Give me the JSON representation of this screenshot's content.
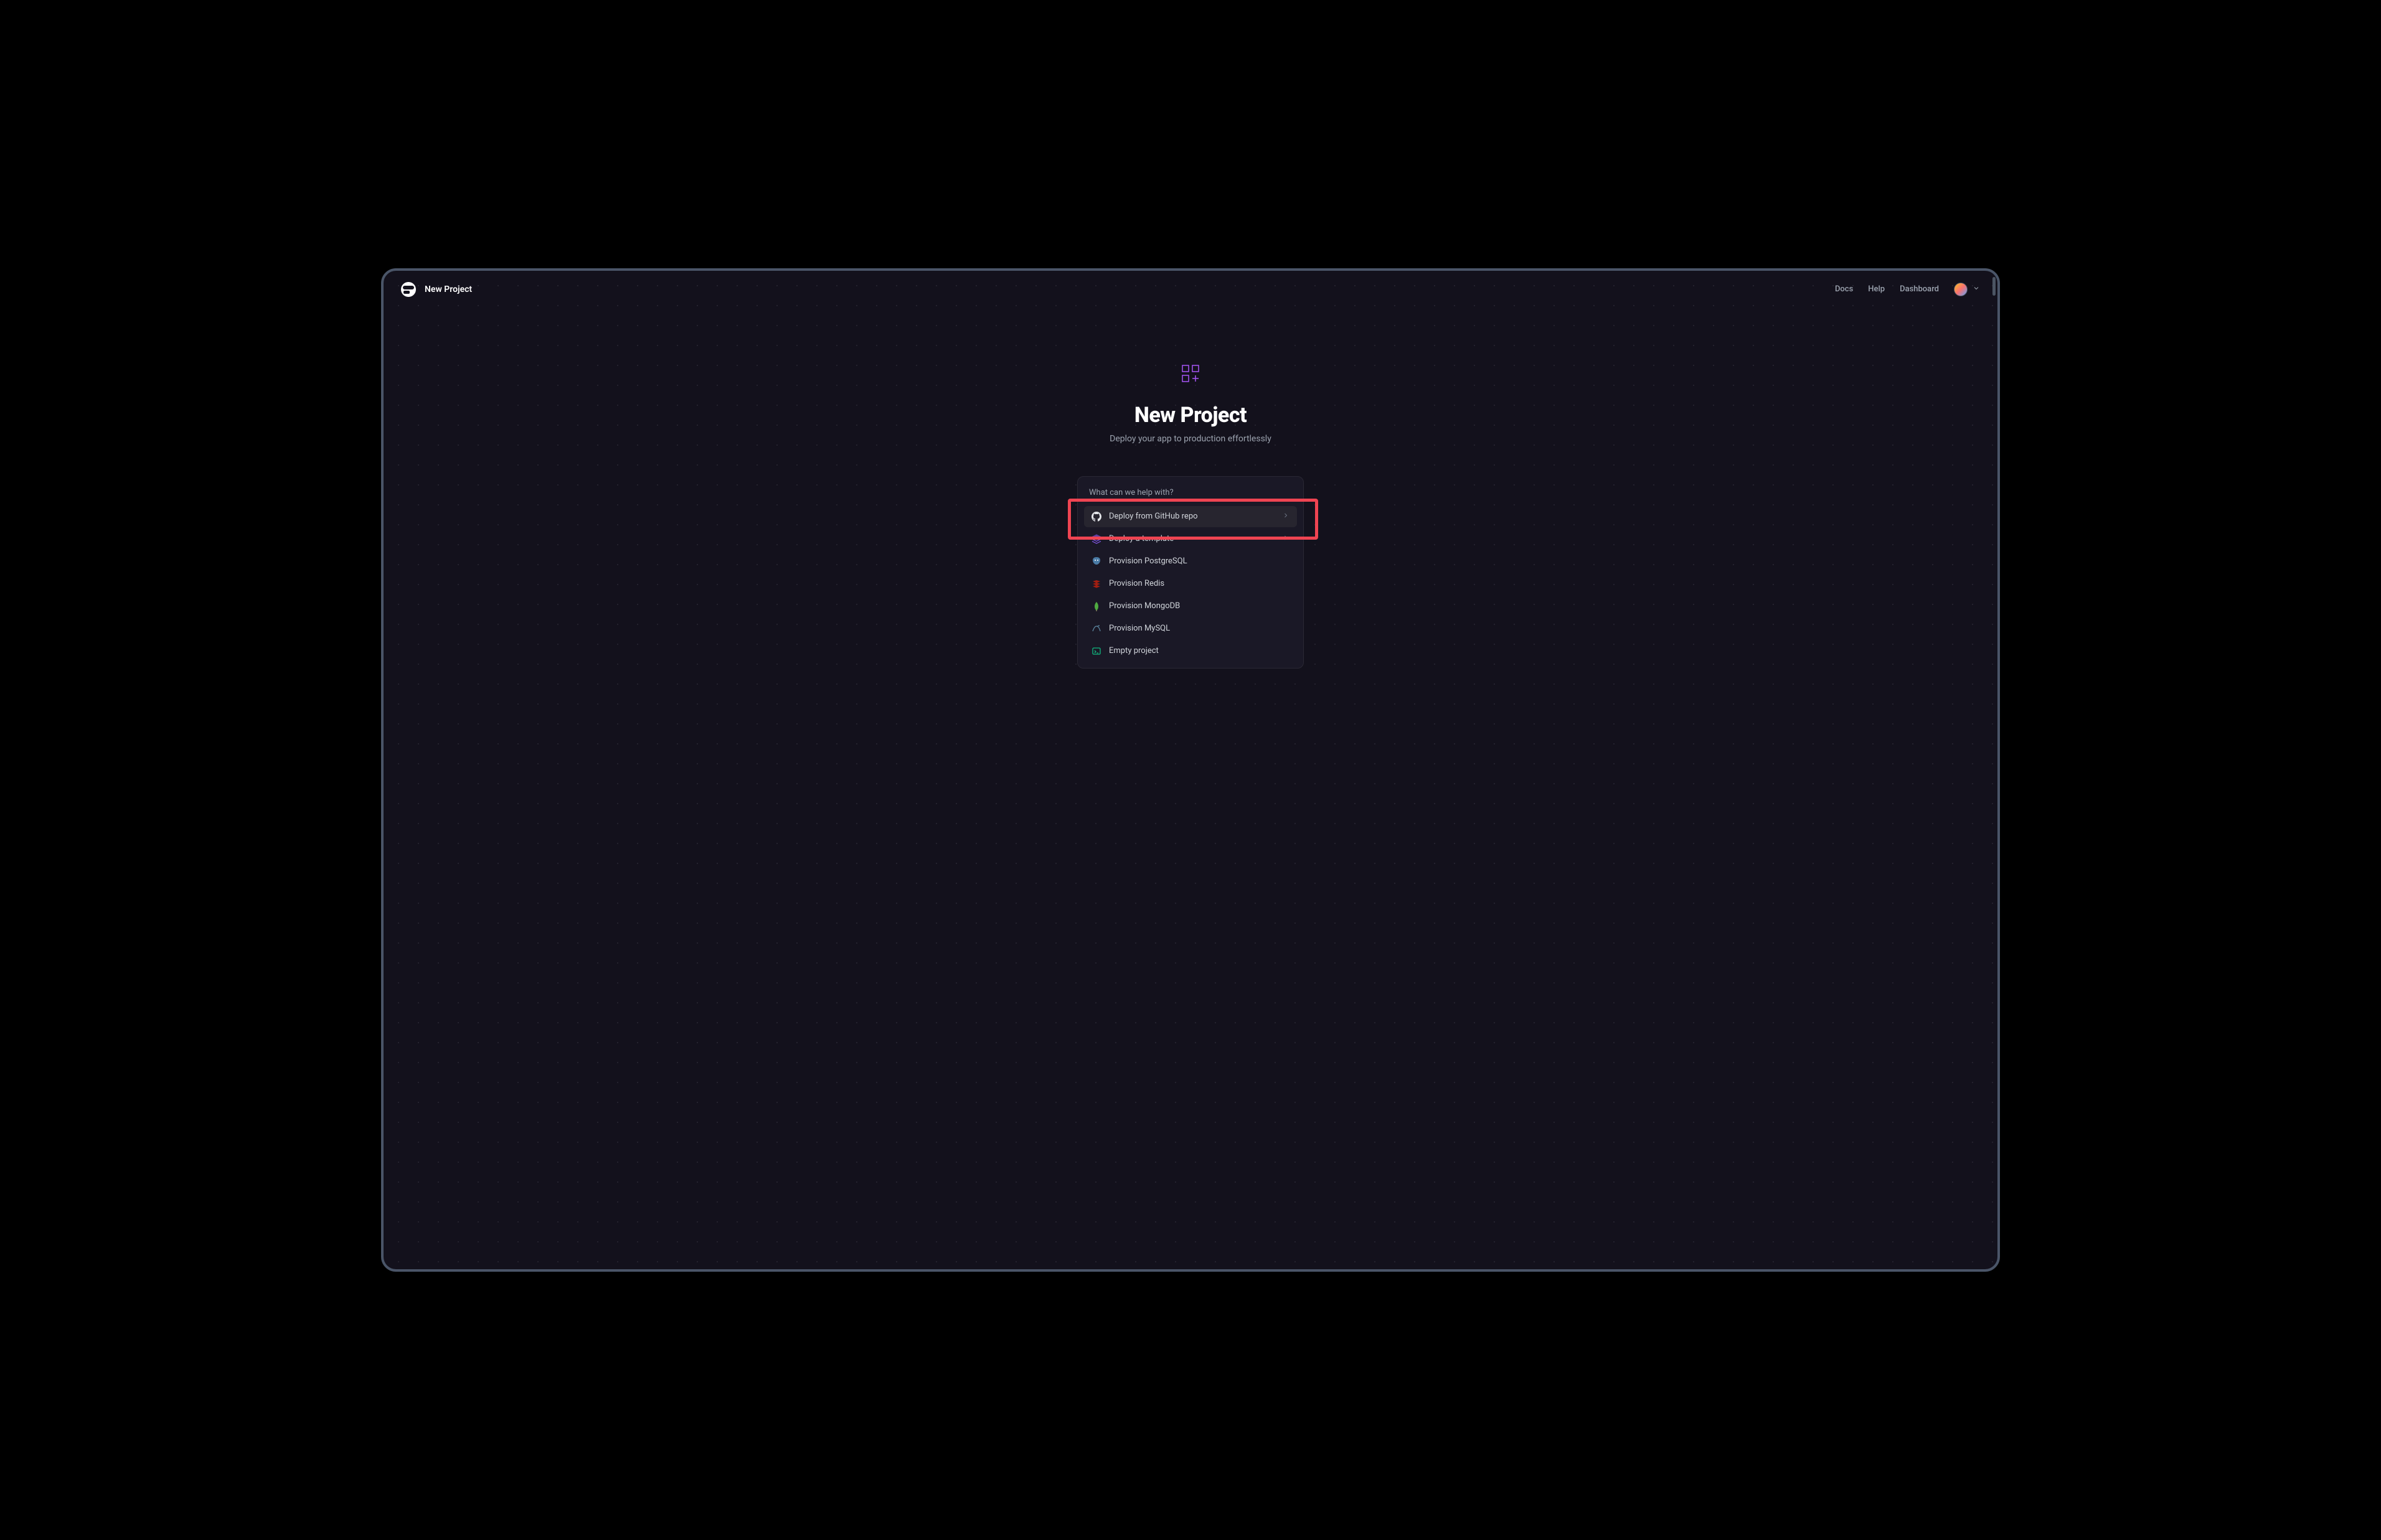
{
  "header": {
    "title": "New Project",
    "nav": {
      "docs": "Docs",
      "help": "Help",
      "dashboard": "Dashboard"
    }
  },
  "hero": {
    "title": "New Project",
    "subtitle": "Deploy your app to production effortlessly"
  },
  "panel": {
    "prompt": "What can we help with?",
    "options": [
      {
        "label": "Deploy from GitHub repo",
        "icon": "github-icon",
        "selected": true,
        "has_chevron": true
      },
      {
        "label": "Deploy a template",
        "icon": "template-icon",
        "selected": false,
        "has_chevron": true
      },
      {
        "label": "Provision PostgreSQL",
        "icon": "postgresql-icon",
        "selected": false,
        "has_chevron": false
      },
      {
        "label": "Provision Redis",
        "icon": "redis-icon",
        "selected": false,
        "has_chevron": false
      },
      {
        "label": "Provision MongoDB",
        "icon": "mongodb-icon",
        "selected": false,
        "has_chevron": false
      },
      {
        "label": "Provision MySQL",
        "icon": "mysql-icon",
        "selected": false,
        "has_chevron": false
      },
      {
        "label": "Empty project",
        "icon": "empty-project-icon",
        "selected": false,
        "has_chevron": false
      }
    ]
  },
  "annotation": {
    "highlighted_option_index": 0
  },
  "colors": {
    "bg": "#13111C",
    "panel": "#1a1826",
    "accent_highlight": "#ef4452",
    "hero_icon": "#a855f7"
  }
}
